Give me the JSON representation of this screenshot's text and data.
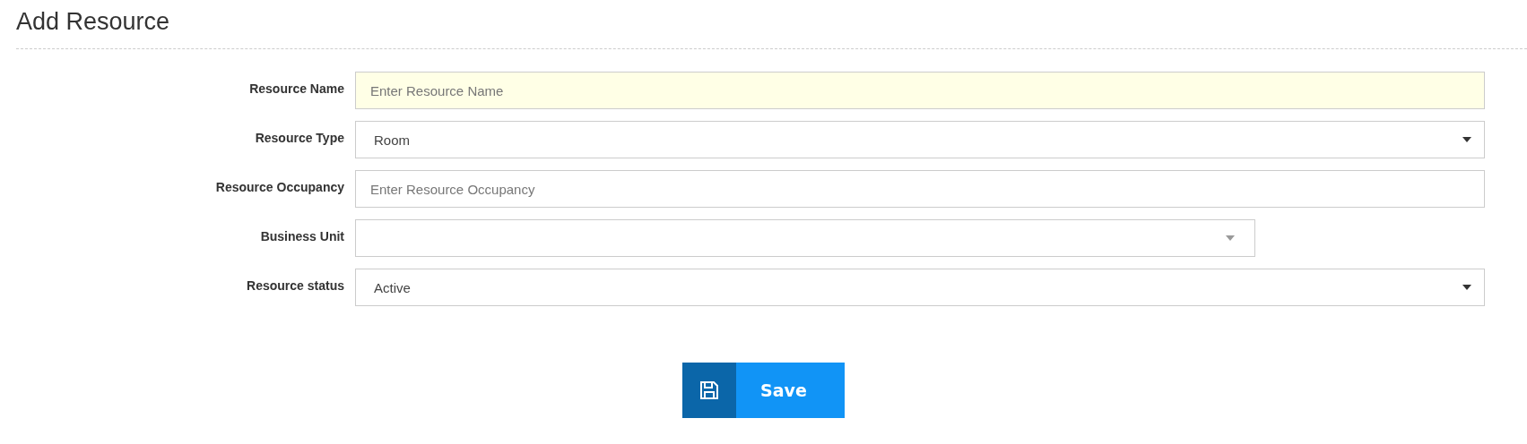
{
  "title": "Add Resource",
  "fields": [
    {
      "label": "Resource Name",
      "kind": "text",
      "placeholder": "Enter Resource Name",
      "highlighted": true
    },
    {
      "label": "Resource Type",
      "kind": "select",
      "value": "Room",
      "highlighted": false
    },
    {
      "label": "Resource Occupancy",
      "kind": "text",
      "placeholder": "Enter Resource Occupancy",
      "highlighted": false
    },
    {
      "label": "Business Unit",
      "kind": "search-select",
      "highlighted": false
    },
    {
      "label": "Resource status",
      "kind": "select",
      "value": "Active",
      "highlighted": false
    }
  ],
  "save_button": {
    "label": "Save"
  }
}
